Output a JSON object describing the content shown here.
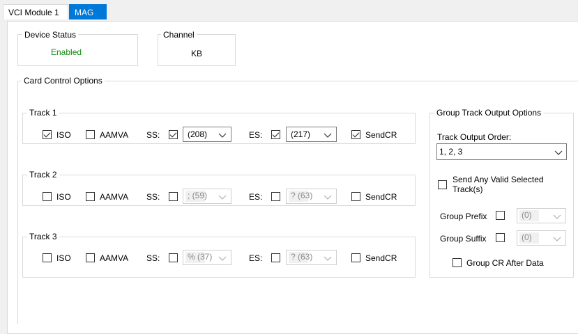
{
  "tabs": [
    {
      "label": "VCI Module 1"
    },
    {
      "label": "MAG"
    }
  ],
  "device_status": {
    "title": "Device Status",
    "value": "Enabled",
    "value_color": "#108a10"
  },
  "channel": {
    "title": "Channel",
    "value": "KB"
  },
  "card_control": {
    "title": "Card Control Options"
  },
  "tracks": [
    {
      "title": "Track 1",
      "iso_label": "ISO",
      "iso_checked": true,
      "aamva_label": "AAMVA",
      "aamva_checked": false,
      "ss_label": "SS:",
      "ss_checked": true,
      "ss_value": "(208)",
      "ss_enabled": true,
      "es_label": "ES:",
      "es_checked": true,
      "es_value": "(217)",
      "es_enabled": true,
      "sendcr_label": "SendCR",
      "sendcr_checked": true
    },
    {
      "title": "Track 2",
      "iso_label": "ISO",
      "iso_checked": false,
      "aamva_label": "AAMVA",
      "aamva_checked": false,
      "ss_label": "SS:",
      "ss_checked": false,
      "ss_value": "; (59)",
      "ss_enabled": false,
      "es_label": "ES:",
      "es_checked": false,
      "es_value": "? (63)",
      "es_enabled": false,
      "sendcr_label": "SendCR",
      "sendcr_checked": false
    },
    {
      "title": "Track 3",
      "iso_label": "ISO",
      "iso_checked": false,
      "aamva_label": "AAMVA",
      "aamva_checked": false,
      "ss_label": "SS:",
      "ss_checked": false,
      "ss_value": "% (37)",
      "ss_enabled": false,
      "es_label": "ES:",
      "es_checked": false,
      "es_value": "? (63)",
      "es_enabled": false,
      "sendcr_label": "SendCR",
      "sendcr_checked": false
    }
  ],
  "group_output": {
    "title": "Group Track Output Options",
    "order_label": "Track Output Order:",
    "order_value": "1, 2, 3",
    "send_any_line1": "Send Any Valid Selected",
    "send_any_line2": "Track(s)",
    "send_any_checked": false,
    "prefix_label": "Group Prefix",
    "prefix_checked": false,
    "prefix_value": "(0)",
    "suffix_label": "Group Suffix",
    "suffix_checked": false,
    "suffix_value": "(0)",
    "cr_after_label": "Group CR After Data",
    "cr_after_checked": false
  },
  "colors": {
    "tab_active": "#0078d7",
    "border": "#d9d9d9",
    "enabled_text": "#108a10"
  }
}
